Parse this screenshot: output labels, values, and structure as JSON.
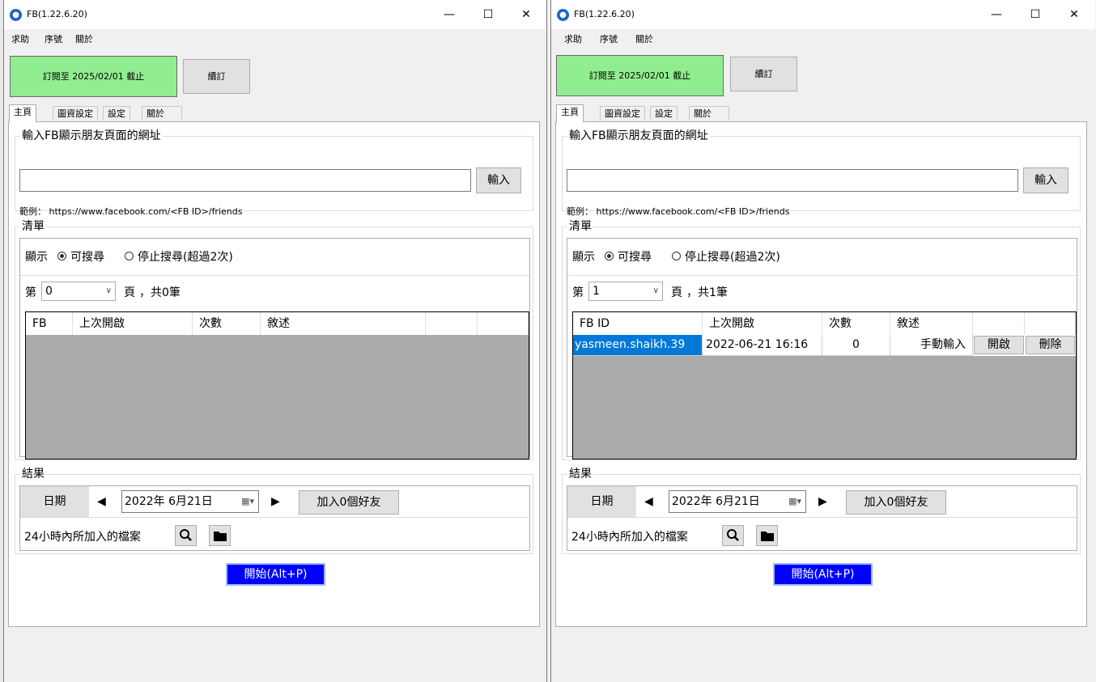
{
  "windows": [
    {
      "title": "FB(1.22.6.20)",
      "controls": {
        "minimize": "—",
        "maximize": "☐",
        "close": "✕"
      },
      "menu": [
        "求助",
        "序號",
        "關於"
      ],
      "subscription": "訂閱至 2025/02/01 截止",
      "renew_label": "續訂",
      "tabs": [
        "主頁",
        "圖資設定",
        "設定",
        "關於"
      ],
      "url_group": {
        "title": "輸入FB顯示朋友頁面的網址",
        "value": "",
        "enter_label": "輸入",
        "example": "範例： https://www.facebook.com/<FB ID>/friends"
      },
      "list_group": {
        "title": "清單",
        "show_label": "顯示",
        "radio_searchable": "可搜尋",
        "radio_stopped": "停止搜尋(超過2次)",
        "page_prefix": "第",
        "page_value": "0",
        "page_suffix": "頁",
        "total": "，共0筆",
        "columns": [
          "FB",
          "上次開啟",
          "次數",
          "敘述",
          "",
          ""
        ],
        "rows": []
      },
      "result_group": {
        "title": "結果",
        "date_label": "日期",
        "prev": "◀",
        "date_value": "2022年  6月21日",
        "next": "▶",
        "add_button": "加入0個好友",
        "files_label": "24小時內所加入的檔案"
      },
      "start_label": "開始(Alt+P)"
    },
    {
      "title": "FB(1.22.6.20)",
      "controls": {
        "minimize": "—",
        "maximize": "☐",
        "close": "✕"
      },
      "menu": [
        "求助",
        "序號",
        "關於"
      ],
      "subscription": "訂閱至 2025/02/01 截止",
      "renew_label": "續訂",
      "tabs": [
        "主頁",
        "圖資設定",
        "設定",
        "關於"
      ],
      "url_group": {
        "title": "輸入FB顯示朋友頁面的網址",
        "value": "",
        "enter_label": "輸入",
        "example": "範例： https://www.facebook.com/<FB ID>/friends"
      },
      "list_group": {
        "title": "清單",
        "show_label": "顯示",
        "radio_searchable": "可搜尋",
        "radio_stopped": "停止搜尋(超過2次)",
        "page_prefix": "第",
        "page_value": "1",
        "page_suffix": "頁",
        "total": "，共1筆",
        "columns": [
          "FB ID",
          "上次開啟",
          "次數",
          "敘述",
          "",
          ""
        ],
        "rows": [
          {
            "fb_id": "yasmeen.shaikh.39",
            "last_opened": "2022-06-21 16:16",
            "count": "0",
            "desc": "手動輸入",
            "open": "開啟",
            "delete": "刪除"
          }
        ]
      },
      "result_group": {
        "title": "結果",
        "date_label": "日期",
        "prev": "◀",
        "date_value": "2022年  6月21日",
        "next": "▶",
        "add_button": "加入0個好友",
        "files_label": "24小時內所加入的檔案"
      },
      "start_label": "開始(Alt+P)"
    }
  ]
}
